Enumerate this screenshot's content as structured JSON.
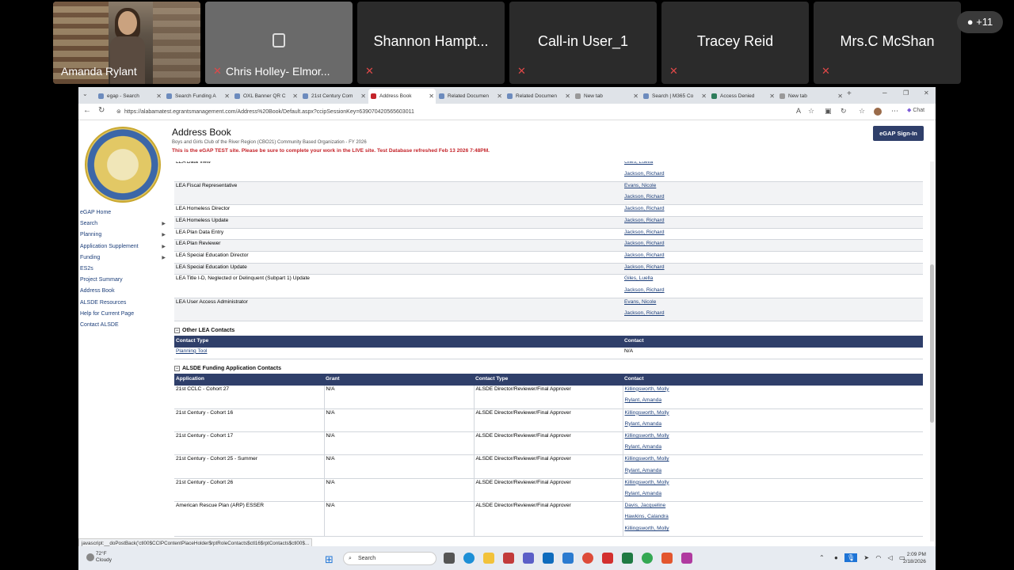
{
  "meeting": {
    "participants": [
      {
        "name": "Amanda Rylant",
        "type": "video"
      },
      {
        "name": "Chris Holley- Elmor...",
        "type": "active"
      },
      {
        "name": "Shannon Hampt...",
        "type": "muted"
      },
      {
        "name": "Call-in User_1",
        "type": "muted"
      },
      {
        "name": "Tracey Reid",
        "type": "muted"
      },
      {
        "name": "Mrs.C McShan",
        "type": "muted"
      }
    ],
    "more_count": "+11"
  },
  "browser": {
    "tabs": [
      "egap - Search",
      "Search Funding A",
      "OXL Banner QR C",
      "21st Century Com",
      "Address Book",
      "Related Documen",
      "Related Documen",
      "New tab",
      "Search | M365 Co",
      "Access Denied",
      "New tab"
    ],
    "url": "https://alabamatest.egrantsmanagement.com/Address%20Book/Default.aspx?ccipSessionKey=639070420565603011",
    "chat_label": "Chat",
    "status_url": "javascript:__doPostBack('ctl00$CCIPContentPlaceHolder$rptRoleContacts$ctl16$rptContacts$ctl00$..."
  },
  "page": {
    "title": "Address Book",
    "subtitle": "Boys and Girls Club of the River Region (CBO21) Community Based Organization - FY 2026",
    "warning": "This is the eGAP TEST site. Please be sure to complete your work in the LIVE site. Test Database refreshed Feb 13 2026 7:48PM.",
    "signin": "eGAP Sign-In",
    "nav": [
      {
        "label": "eGAP Home",
        "arrow": false
      },
      {
        "label": "Search",
        "arrow": true
      },
      {
        "label": "Planning",
        "arrow": true
      },
      {
        "label": "Application Supplement",
        "arrow": true
      },
      {
        "label": "Funding",
        "arrow": true
      },
      {
        "label": "ES2s",
        "arrow": false
      },
      {
        "label": "Project Summary",
        "arrow": false
      },
      {
        "label": "Address Book",
        "arrow": false
      },
      {
        "label": "ALSDE Resources",
        "arrow": false
      },
      {
        "label": "Help for Current Page",
        "arrow": false
      },
      {
        "label": "Contact ALSDE",
        "arrow": false
      }
    ],
    "roles": [
      {
        "role": "LEA Data View",
        "contacts": [
          "Giles, Luella",
          "Jackson, Richard"
        ]
      },
      {
        "role": "LEA Fiscal Representative",
        "contacts": [
          "Evans, Nicole",
          "Jackson, Richard"
        ]
      },
      {
        "role": "LEA Homeless Director",
        "contacts": [
          "Jackson, Richard"
        ]
      },
      {
        "role": "LEA Homeless Update",
        "contacts": [
          "Jackson, Richard"
        ]
      },
      {
        "role": "LEA Plan Data Entry",
        "contacts": [
          "Jackson, Richard"
        ]
      },
      {
        "role": "LEA Plan Reviewer",
        "contacts": [
          "Jackson, Richard"
        ]
      },
      {
        "role": "LEA Special Education Director",
        "contacts": [
          "Jackson, Richard"
        ]
      },
      {
        "role": "LEA Special Education Update",
        "contacts": [
          "Jackson, Richard"
        ]
      },
      {
        "role": "LEA Title I-D, Neglected or Delinquent (Subpart 1) Update",
        "contacts": [
          "Giles, Luella",
          "Jackson, Richard"
        ]
      },
      {
        "role": "LEA User Access Administrator",
        "contacts": [
          "Evans, Nicole",
          "Jackson, Richard"
        ]
      }
    ],
    "other_lea": {
      "heading": "Other LEA Contacts",
      "toggle": "−",
      "headers": [
        "Contact Type",
        "Contact"
      ],
      "rows": [
        {
          "type": "Planning Tool",
          "contact": "N/A"
        }
      ]
    },
    "funding": {
      "heading": "ALSDE Funding Application Contacts",
      "toggle": "−",
      "headers": [
        "Application",
        "Grant",
        "Contact Type",
        "Contact"
      ],
      "rows": [
        {
          "app": "21st CCLC - Cohort 27",
          "grant": "N/A",
          "type": "ALSDE Director/Reviewer/Final Approver",
          "contacts": [
            "Killingsworth, Molly",
            "Rylant, Amanda"
          ]
        },
        {
          "app": "21st Century - Cohort 16",
          "grant": "N/A",
          "type": "ALSDE Director/Reviewer/Final Approver",
          "contacts": [
            "Killingsworth, Molly",
            "Rylant, Amanda"
          ]
        },
        {
          "app": "21st Century - Cohort 17",
          "grant": "N/A",
          "type": "ALSDE Director/Reviewer/Final Approver",
          "contacts": [
            "Killingsworth, Molly",
            "Rylant, Amanda"
          ]
        },
        {
          "app": "21st Century - Cohort 25 - Summer",
          "grant": "N/A",
          "type": "ALSDE Director/Reviewer/Final Approver",
          "contacts": [
            "Killingsworth, Molly",
            "Rylant, Amanda"
          ]
        },
        {
          "app": "21st Century - Cohort 26",
          "grant": "N/A",
          "type": "ALSDE Director/Reviewer/Final Approver",
          "contacts": [
            "Killingsworth, Molly",
            "Rylant, Amanda"
          ]
        },
        {
          "app": "American Rescue Plan (ARP) ESSER",
          "grant": "N/A",
          "type": "ALSDE Director/Reviewer/Final Approver",
          "contacts": [
            "Davis, Jacqueline",
            "Hawkins, Calandra",
            "Killingsworth, Molly"
          ]
        }
      ]
    }
  },
  "taskbar": {
    "temp": "72°F",
    "weather": "Cloudy",
    "search": "Search",
    "time": "2:09 PM",
    "date": "2/18/2026"
  }
}
